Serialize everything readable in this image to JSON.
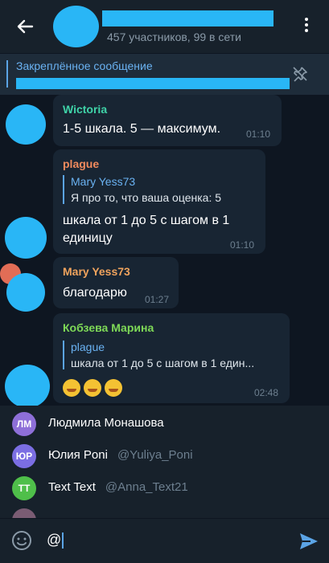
{
  "header": {
    "subtitle": "457 участников, 99 в сети",
    "icons": {
      "back": "arrow-left-icon",
      "menu": "more-vertical-icon"
    }
  },
  "pinned": {
    "label": "Закреплённое сообщение",
    "icon": "unpin-icon"
  },
  "messages": [
    {
      "sender": "Wictoria",
      "sender_color": "#3fd3a8",
      "text": "1-5 шкала. 5 — максимум.",
      "time": "01:10"
    },
    {
      "sender": "plague",
      "sender_color": "#f08a5d",
      "reply_name": "Mary Yess73",
      "reply_text": "Я про то, что ваша оценка: 5",
      "text_line1": "шкала от 1 до 5 с шагом в 1",
      "text_line2": "единицу",
      "time": "01:10"
    },
    {
      "sender": "Mary Yess73",
      "sender_color": "#f0a35d",
      "text": "благодарю",
      "time": "01:27"
    },
    {
      "sender": "Кобзева Марина",
      "sender_color": "#7ed957",
      "reply_name": "plague",
      "reply_text": "шкала от 1 до 5 с шагом в 1 един...",
      "time": "02:48"
    }
  ],
  "mentions": [
    {
      "initials": "ЛМ",
      "name": "Людмила Монашова",
      "username": "",
      "color": "#8e6fd8"
    },
    {
      "initials": "ЮР",
      "name": "Юлия Poni",
      "username": "@Yuliya_Poni",
      "color": "#7b6ee3"
    },
    {
      "initials": "TT",
      "name": "Text Text",
      "username": "@Anna_Text21",
      "color": "#4fbf4a"
    }
  ],
  "input": {
    "value": "@",
    "icons": {
      "emoji": "smiley-icon",
      "send": "send-icon"
    }
  },
  "colors": {
    "accent": "#29b6f6",
    "background": "#0e1621",
    "bubble": "#182533",
    "bar": "#17212b"
  }
}
